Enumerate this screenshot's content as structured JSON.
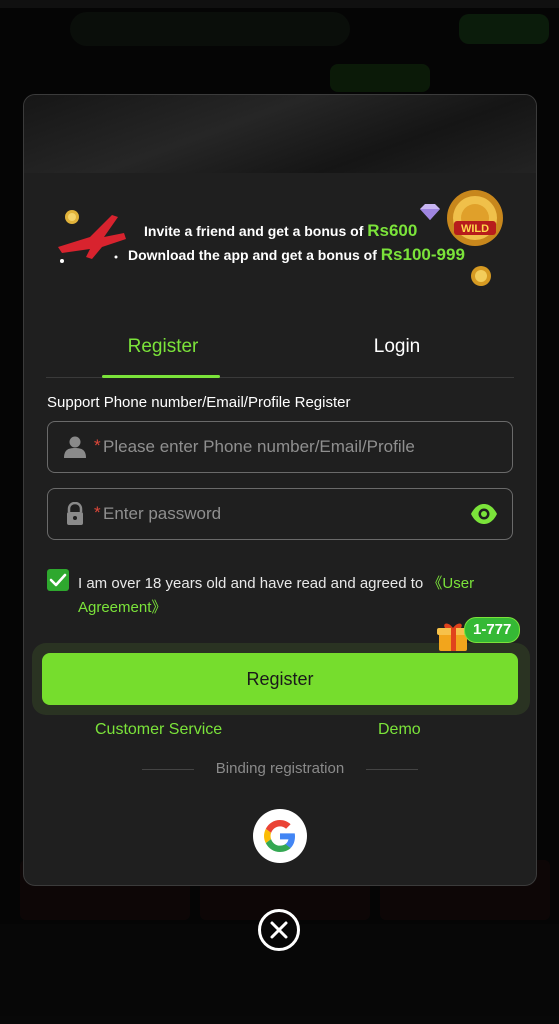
{
  "banner": {
    "line1_text": "Invite a friend and get a bonus of",
    "line1_amount": "Rs600",
    "line2_text": "Download the app and get a bonus of",
    "line2_amount": "Rs100-999",
    "badge_text": "WILD"
  },
  "tabs": [
    {
      "label": "Register",
      "active": true
    },
    {
      "label": "Login",
      "active": false
    }
  ],
  "form": {
    "support_label": "Support Phone number/Email/Profile Register",
    "account_required_mark": "*",
    "account_placeholder": "Please enter Phone number/Email/Profile",
    "password_required_mark": "*",
    "password_placeholder": "Enter password",
    "agree_text": "I am over 18 years old and have read and agreed to",
    "agree_link": "《User Agreement》",
    "agree_checked": true,
    "submit_label": "Register",
    "bonus_badge": "1-777"
  },
  "links": {
    "customer_service": "Customer Service",
    "demo": "Demo"
  },
  "binding": {
    "label": "Binding registration",
    "providers": [
      "google-icon"
    ]
  },
  "icons": {
    "account_field": "user-icon",
    "password_field": "lock-icon",
    "toggle_visibility": "eye-icon",
    "close": "close-icon",
    "gift": "gift-icon"
  },
  "colors": {
    "accent": "#7be33a",
    "button": "#76dd2d",
    "required": "#e0483a",
    "modal_bg": "#1f1f1f"
  }
}
